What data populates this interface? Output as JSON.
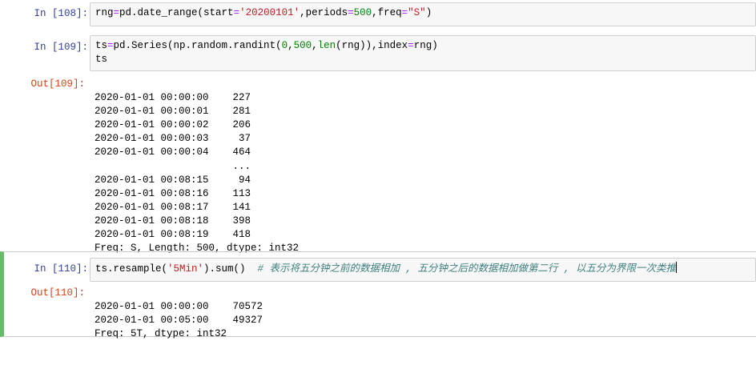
{
  "cells": [
    {
      "in_prompt": "In  [108]:",
      "code_lines": [
        "rng=pd.date_range(start='20200101',periods=500,freq=\"S\")"
      ]
    },
    {
      "in_prompt": "In  [109]:",
      "code_lines": [
        "ts=pd.Series(np.random.randint(0,500,len(rng)),index=rng)",
        "ts"
      ],
      "out_prompt": "Out[109]:",
      "output_lines": [
        "2020-01-01 00:00:00    227",
        "2020-01-01 00:00:01    281",
        "2020-01-01 00:00:02    206",
        "2020-01-01 00:00:03     37",
        "2020-01-01 00:00:04    464",
        "                       ...",
        "2020-01-01 00:08:15     94",
        "2020-01-01 00:08:16    113",
        "2020-01-01 00:08:17    141",
        "2020-01-01 00:08:18    398",
        "2020-01-01 00:08:19    418",
        "Freq: S, Length: 500, dtype: int32"
      ]
    },
    {
      "in_prompt": "In  [110]:",
      "code_lines": [
        "ts.resample('5Min').sum()  # 表示将五分钟之前的数据相加 , 五分钟之后的数据相加做第二行 , 以五分为界限一次类推"
      ],
      "out_prompt": "Out[110]:",
      "output_lines": [
        "2020-01-01 00:00:00    70572",
        "2020-01-01 00:05:00    49327",
        "Freq: 5T, dtype: int32"
      ]
    }
  ]
}
